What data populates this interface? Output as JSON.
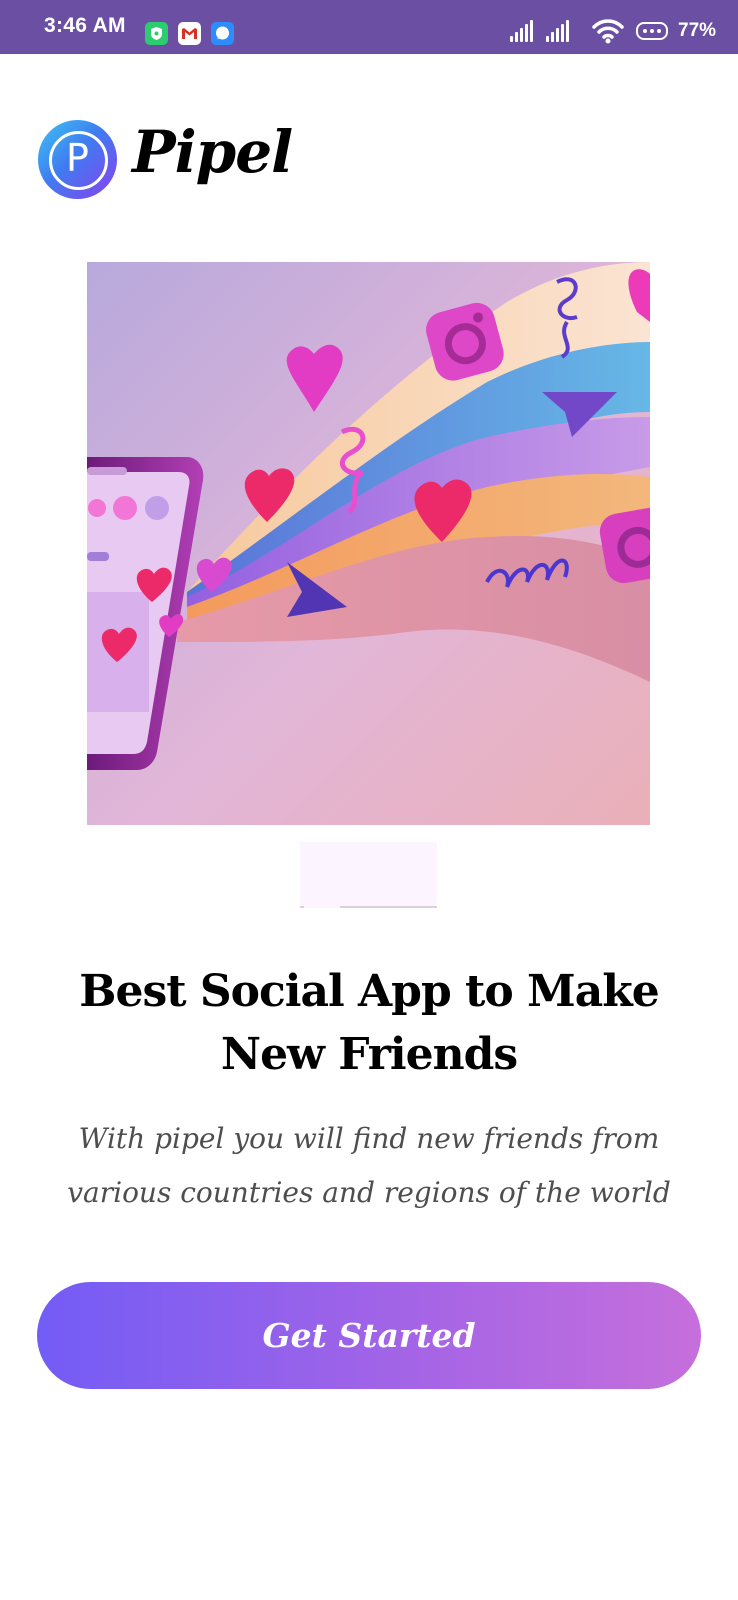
{
  "status_bar": {
    "time": "3:46 AM",
    "notification_icons": [
      "shield-icon",
      "gmail-icon",
      "message-icon"
    ],
    "system_icons": [
      "signal-icon",
      "signal-icon",
      "wifi-icon",
      "battery-icon"
    ],
    "battery": "77%",
    "background_color": "#6a4fa3"
  },
  "brand": {
    "logo_letter": "P",
    "name": "Pipel"
  },
  "hero": {
    "image_icon": "social-media-illustration"
  },
  "onboarding": {
    "title": "Best Social App to Make New Friends",
    "description": "With pipel you will find new friends from various countries and regions of the world"
  },
  "actions": {
    "get_started_label": "Get Started",
    "accent_start": "#735cf6",
    "accent_end": "#c66fdc"
  }
}
